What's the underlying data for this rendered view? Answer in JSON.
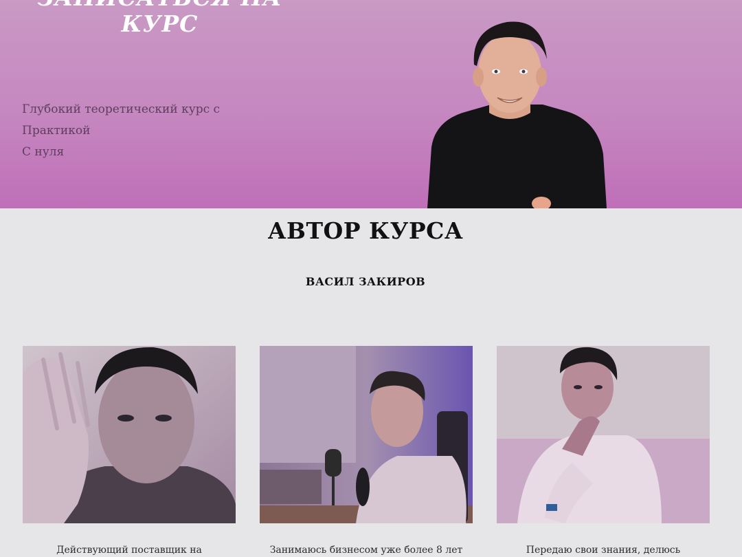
{
  "hero": {
    "title_line1": "ЗАПИСАТЬСЯ НА",
    "title_line2": "КУРС",
    "subtitle_lines": [
      "Глубокий теоретический курс с",
      "Практикой",
      "С нуля"
    ]
  },
  "author_section": {
    "title": "АВТОР КУРСА",
    "name": "ВАСИЛ ЗАКИРОВ"
  },
  "cards": [
    {
      "text": "Действующий поставщик на"
    },
    {
      "text": "Занимаюсь бизнесом уже более 8 лет"
    },
    {
      "text": "Передаю свои знания, делюсь"
    }
  ],
  "colors": {
    "hero_top": "#c99ac4",
    "hero_bottom": "#bf6fb8",
    "page_bg": "#e6e6e8",
    "title_text": "#111111",
    "hero_title": "#ffffff"
  }
}
